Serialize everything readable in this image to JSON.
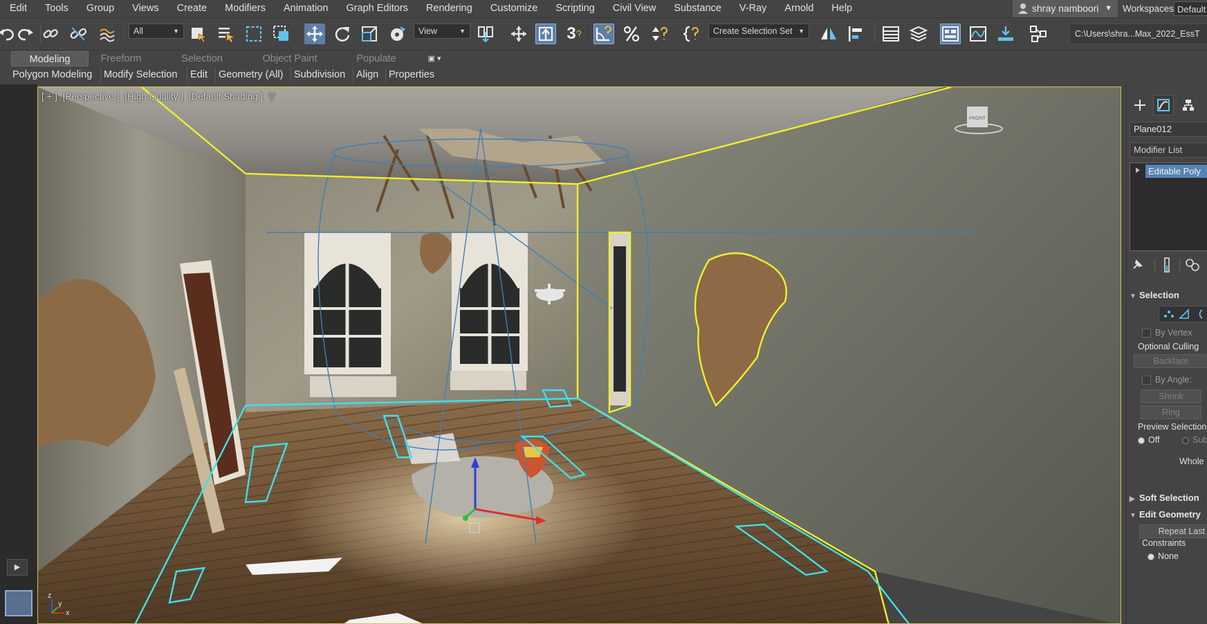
{
  "menu": {
    "items": [
      "Edit",
      "Tools",
      "Group",
      "Views",
      "Create",
      "Modifiers",
      "Animation",
      "Graph Editors",
      "Rendering",
      "Customize",
      "Scripting",
      "Civil View",
      "Substance",
      "V-Ray",
      "Arnold",
      "Help"
    ]
  },
  "user": {
    "name": "shray namboori"
  },
  "workspaces": {
    "label": "Workspaces:",
    "value": "Default"
  },
  "toolbar": {
    "selection_filter": "All",
    "ref_coord": "View",
    "named_selection": "Create Selection Set",
    "snap_label": "3",
    "path": "C:\\Users\\shra...Max_2022_EssT",
    "icons": [
      "undo-icon",
      "redo-icon",
      "link-icon",
      "unlink-icon",
      "bind-space-warp-icon",
      "select-object-icon",
      "select-by-name-icon",
      "rect-selection-icon",
      "window-crossing-icon",
      "move-icon",
      "rotate-icon",
      "scale-icon",
      "placement-icon",
      "use-pivot-icon",
      "select-manipulate-icon",
      "keyboard-shortcut-icon",
      "snaps-icon",
      "angle-snap-icon",
      "percent-snap-icon",
      "spinner-snap-icon",
      "edit-named-sets-icon",
      "mirror-icon",
      "align-icon",
      "scene-explorer-icon",
      "layer-explorer-icon",
      "ribbon-toggle-icon",
      "curve-editor-icon",
      "render-setup-icon",
      "schematic-icon"
    ]
  },
  "ribbon": {
    "tabs": [
      "Modeling",
      "Freeform",
      "Selection",
      "Object Paint",
      "Populate"
    ],
    "active_tab": "Modeling",
    "panels": [
      "Polygon Modeling",
      "Modify Selection",
      "Edit",
      "Geometry (All)",
      "Subdivision",
      "Align",
      "Properties"
    ]
  },
  "viewport": {
    "label_parts": [
      "[ + ]",
      "[Perspective ]",
      "[High Quality ]",
      "[Default Shading ]"
    ],
    "viewcube_label": "FRONT",
    "axis_labels": {
      "x": "x",
      "y": "y",
      "z": "z"
    },
    "highlight_colors": {
      "selected": "#f0ef2a",
      "helper": "#3fe0ea",
      "wire": "#3e7fb8"
    }
  },
  "command_panel": {
    "object_name": "Plane012",
    "modifier_list": "Modifier List",
    "stack_item": "Editable Poly",
    "selection_title": "Selection",
    "by_vertex": "By Vertex",
    "optional_culling": "Optional Culling",
    "backface": "Backface",
    "by_angle": "By Angle:",
    "shrink": "Shrink",
    "ring": "Ring",
    "preview_selection": "Preview Selection",
    "preview_off": "Off",
    "preview_subobj": "SubObj",
    "whole": "Whole",
    "soft_selection": "Soft Selection",
    "edit_geometry": "Edit Geometry",
    "repeat_last": "Repeat Last",
    "constraints": "Constraints",
    "constraint_none": "None"
  },
  "colors": {
    "accent": "#5f7ea6",
    "panel_bg": "#444444",
    "stack_highlight": "#5683b4",
    "viewport_border": "#d7c04a"
  }
}
